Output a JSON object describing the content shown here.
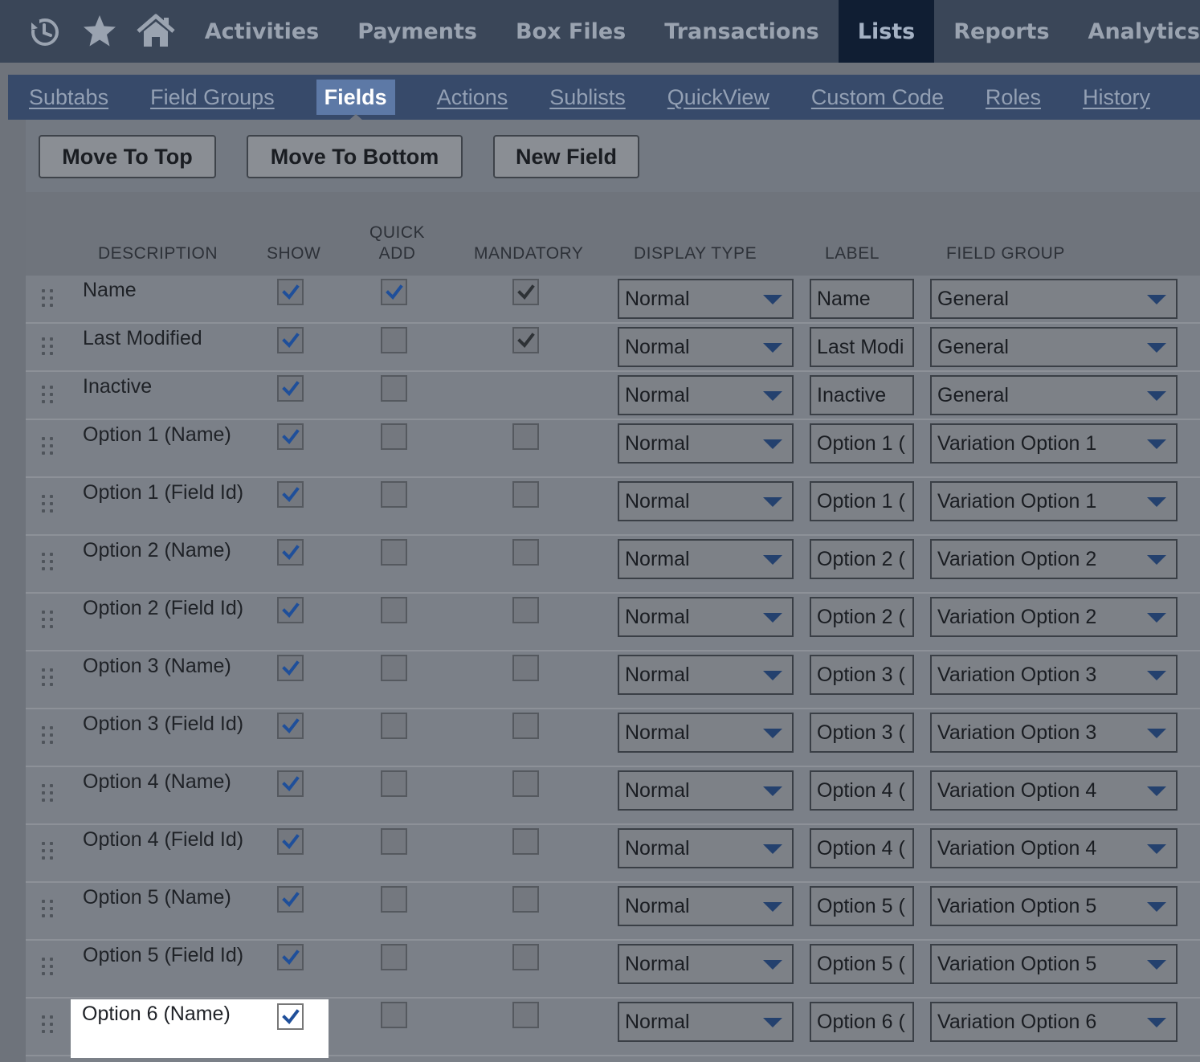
{
  "top_nav": {
    "icons": [
      "history-icon",
      "star-icon",
      "home-icon"
    ],
    "items": [
      {
        "label": "Activities",
        "active": false
      },
      {
        "label": "Payments",
        "active": false
      },
      {
        "label": "Box Files",
        "active": false
      },
      {
        "label": "Transactions",
        "active": false
      },
      {
        "label": "Lists",
        "active": true
      },
      {
        "label": "Reports",
        "active": false
      },
      {
        "label": "Analytics",
        "active": false
      }
    ]
  },
  "subtabs": [
    {
      "label": "Subtabs",
      "active": false
    },
    {
      "label": "Field Groups",
      "active": false
    },
    {
      "label": "Fields",
      "active": true
    },
    {
      "label": "Actions",
      "active": false
    },
    {
      "label": "Sublists",
      "active": false
    },
    {
      "label": "QuickView",
      "active": false
    },
    {
      "label": "Custom Code",
      "active": false
    },
    {
      "label": "Roles",
      "active": false
    },
    {
      "label": "History",
      "active": false
    }
  ],
  "toolbar": {
    "move_top_label": "Move To Top",
    "move_bottom_label": "Move To Bottom",
    "new_field_label": "New Field"
  },
  "table": {
    "headers": {
      "description": "DESCRIPTION",
      "show": "SHOW",
      "quick_add_1": "QUICK",
      "quick_add_2": "ADD",
      "mandatory": "MANDATORY",
      "display_type": "DISPLAY TYPE",
      "label": "LABEL",
      "field_group": "FIELD GROUP"
    },
    "rows": [
      {
        "description": "Name",
        "show": true,
        "quick_add": true,
        "mandatory": true,
        "display_type": "Normal",
        "label": "Name",
        "field_group": "General"
      },
      {
        "description": "Last Modified",
        "show": true,
        "quick_add": false,
        "mandatory": true,
        "display_type": "Normal",
        "label": "Last Modi",
        "field_group": "General"
      },
      {
        "description": "Inactive",
        "show": true,
        "quick_add": false,
        "mandatory": null,
        "display_type": "Normal",
        "label": "Inactive",
        "field_group": "General"
      },
      {
        "description": "Option 1 (Name)",
        "show": true,
        "quick_add": false,
        "mandatory": false,
        "display_type": "Normal",
        "label": "Option 1 (",
        "field_group": "Variation Option 1"
      },
      {
        "description": "Option 1 (Field Id)",
        "show": true,
        "quick_add": false,
        "mandatory": false,
        "display_type": "Normal",
        "label": "Option 1 (",
        "field_group": "Variation Option 1"
      },
      {
        "description": "Option 2 (Name)",
        "show": true,
        "quick_add": false,
        "mandatory": false,
        "display_type": "Normal",
        "label": "Option 2 (",
        "field_group": "Variation Option 2"
      },
      {
        "description": "Option 2 (Field Id)",
        "show": true,
        "quick_add": false,
        "mandatory": false,
        "display_type": "Normal",
        "label": "Option 2 (",
        "field_group": "Variation Option 2"
      },
      {
        "description": "Option 3 (Name)",
        "show": true,
        "quick_add": false,
        "mandatory": false,
        "display_type": "Normal",
        "label": "Option 3 (",
        "field_group": "Variation Option 3"
      },
      {
        "description": "Option 3 (Field Id)",
        "show": true,
        "quick_add": false,
        "mandatory": false,
        "display_type": "Normal",
        "label": "Option 3 (",
        "field_group": "Variation Option 3"
      },
      {
        "description": "Option 4 (Name)",
        "show": true,
        "quick_add": false,
        "mandatory": false,
        "display_type": "Normal",
        "label": "Option 4 (",
        "field_group": "Variation Option 4"
      },
      {
        "description": "Option 4 (Field Id)",
        "show": true,
        "quick_add": false,
        "mandatory": false,
        "display_type": "Normal",
        "label": "Option 4 (",
        "field_group": "Variation Option 4"
      },
      {
        "description": "Option 5 (Name)",
        "show": true,
        "quick_add": false,
        "mandatory": false,
        "display_type": "Normal",
        "label": "Option 5 (",
        "field_group": "Variation Option 5"
      },
      {
        "description": "Option 5 (Field Id)",
        "show": true,
        "quick_add": false,
        "mandatory": false,
        "display_type": "Normal",
        "label": "Option 5 (",
        "field_group": "Variation Option 5"
      },
      {
        "description": "Option 6 (Name)",
        "show": true,
        "quick_add": false,
        "mandatory": false,
        "display_type": "Normal",
        "label": "Option 6 (",
        "field_group": "Variation Option 6"
      }
    ]
  },
  "colors": {
    "nav_bg": "#3a4658",
    "nav_active_bg": "#101e33",
    "subtab_bg": "#374a6a",
    "subtab_active_bg": "#5d79a6",
    "check_blue": "#1f4f9a",
    "check_gray": "#2e3236"
  }
}
